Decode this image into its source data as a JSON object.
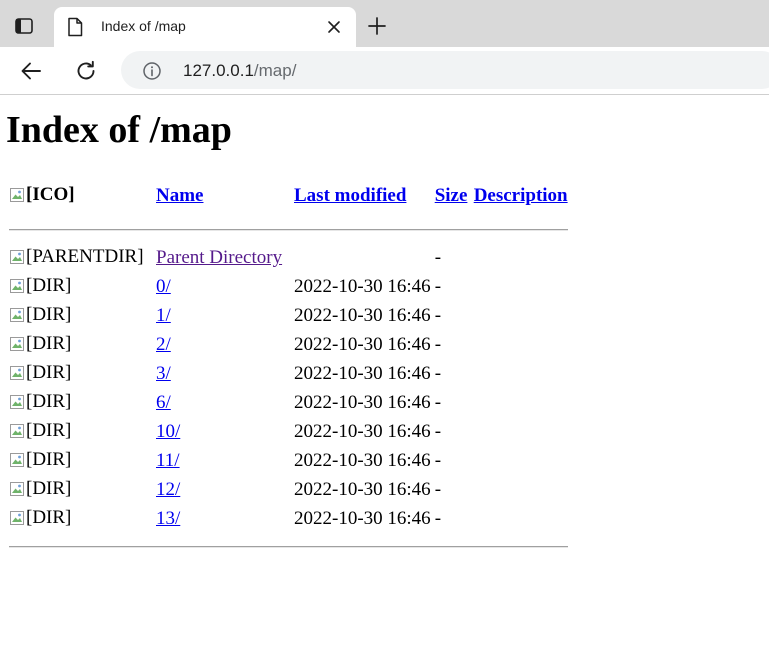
{
  "browser": {
    "tab_title": "Index of /map",
    "url_host": "127.0.0.1",
    "url_path": "/map/"
  },
  "page": {
    "heading": "Index of /map",
    "columns": {
      "icon": "[ICO]",
      "name": "Name",
      "last_modified": "Last modified",
      "size": "Size",
      "description": "Description"
    },
    "parent": {
      "icon_alt": "[PARENTDIR]",
      "name": "Parent Directory",
      "last_modified": "",
      "size": "-"
    },
    "rows": [
      {
        "icon_alt": "[DIR]",
        "name": "0/",
        "last_modified": "2022-10-30 16:46",
        "size": "-"
      },
      {
        "icon_alt": "[DIR]",
        "name": "1/",
        "last_modified": "2022-10-30 16:46",
        "size": "-"
      },
      {
        "icon_alt": "[DIR]",
        "name": "2/",
        "last_modified": "2022-10-30 16:46",
        "size": "-"
      },
      {
        "icon_alt": "[DIR]",
        "name": "3/",
        "last_modified": "2022-10-30 16:46",
        "size": "-"
      },
      {
        "icon_alt": "[DIR]",
        "name": "6/",
        "last_modified": "2022-10-30 16:46",
        "size": "-"
      },
      {
        "icon_alt": "[DIR]",
        "name": "10/",
        "last_modified": "2022-10-30 16:46",
        "size": "-"
      },
      {
        "icon_alt": "[DIR]",
        "name": "11/",
        "last_modified": "2022-10-30 16:46",
        "size": "-"
      },
      {
        "icon_alt": "[DIR]",
        "name": "12/",
        "last_modified": "2022-10-30 16:46",
        "size": "-"
      },
      {
        "icon_alt": "[DIR]",
        "name": "13/",
        "last_modified": "2022-10-30 16:46",
        "size": "-"
      }
    ]
  },
  "colors": {
    "link": "#0000ee",
    "visited_link": "#551a8b",
    "tabstrip": "#d9d9d9",
    "address_bar": "#f1f3f4"
  }
}
